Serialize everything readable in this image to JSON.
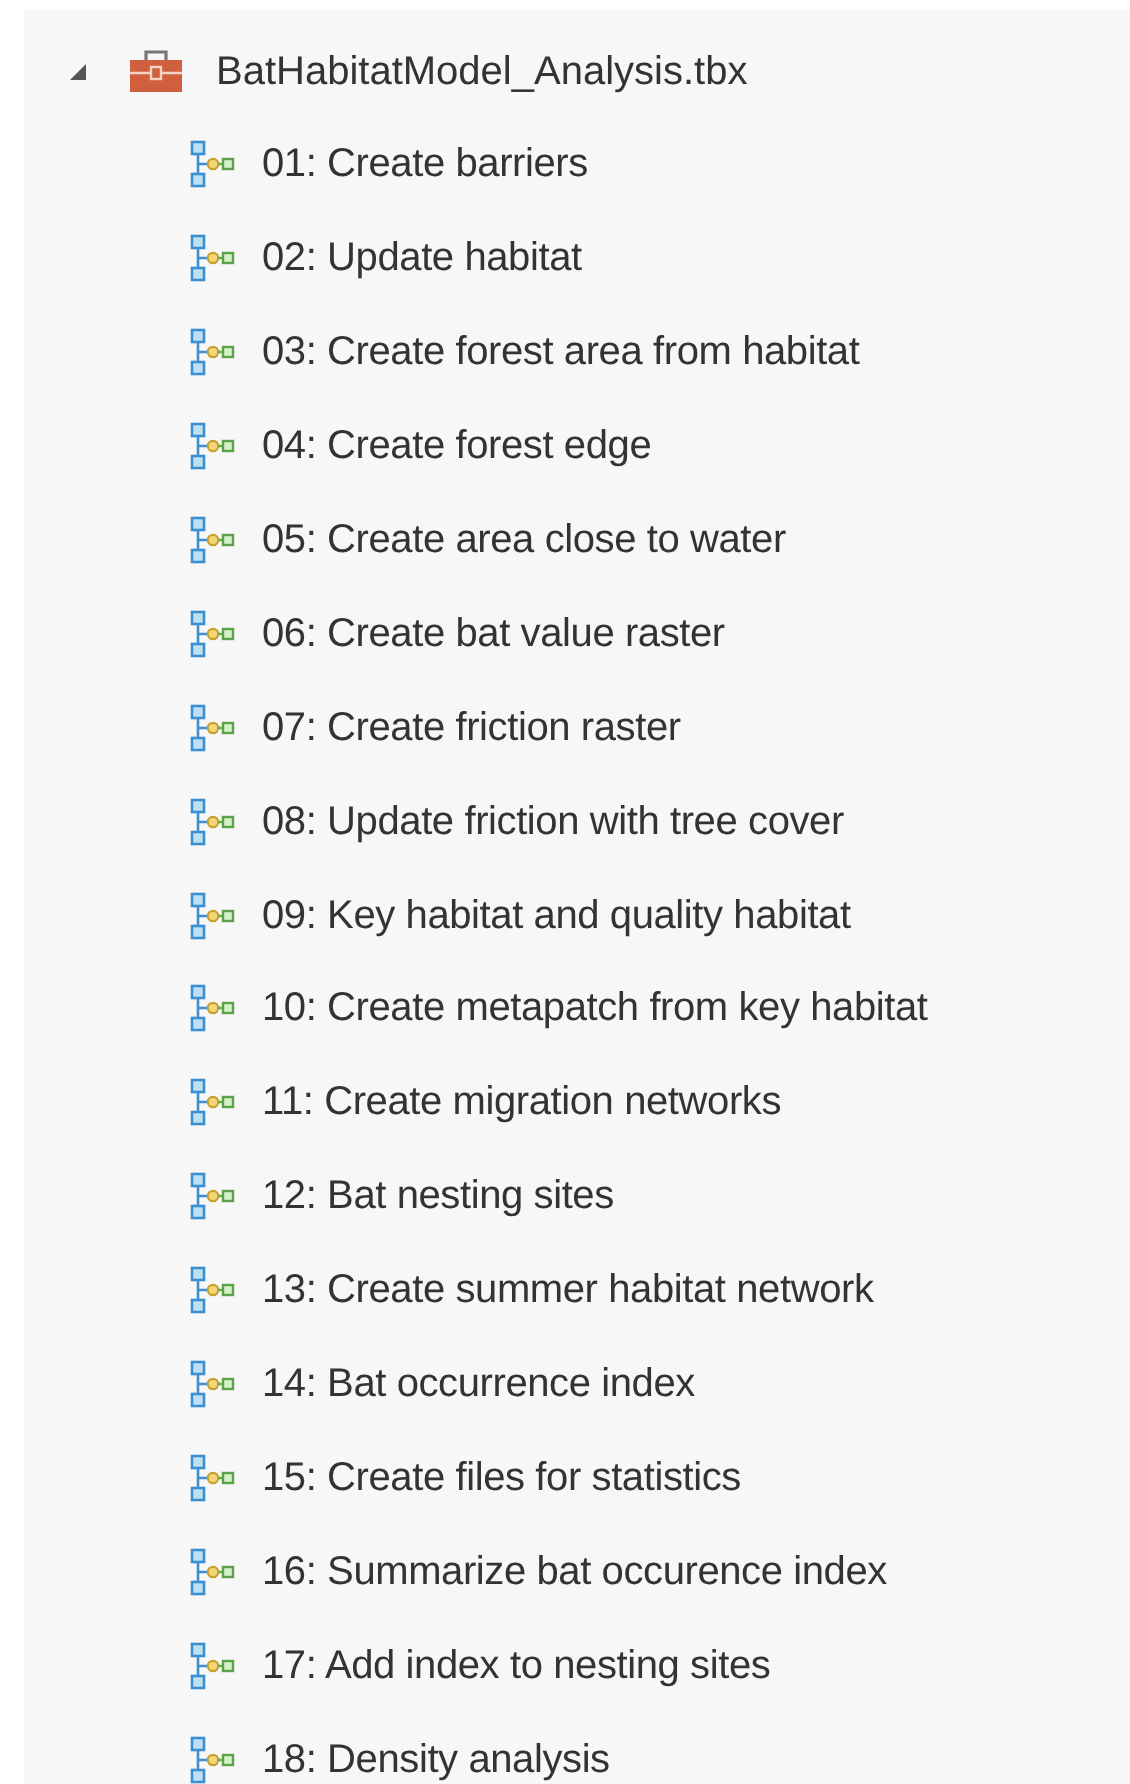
{
  "tree": {
    "label": "BatHabitatModel_Analysis.tbx",
    "expanded": true,
    "children": [
      {
        "label": "01: Create barriers"
      },
      {
        "label": "02: Update habitat"
      },
      {
        "label": "03: Create forest area from habitat"
      },
      {
        "label": "04: Create forest edge"
      },
      {
        "label": "05: Create area close to water"
      },
      {
        "label": "06: Create bat value raster"
      },
      {
        "label": "07: Create friction raster"
      },
      {
        "label": "08: Update friction with tree cover"
      },
      {
        "label": "09: Key habitat and quality habitat"
      },
      {
        "label": "10: Create metapatch from key habitat"
      },
      {
        "label": "11: Create migration networks"
      },
      {
        "label": "12: Bat nesting sites"
      },
      {
        "label": "13: Create summer habitat network"
      },
      {
        "label": "14: Bat occurrence index"
      },
      {
        "label": "15: Create files for statistics"
      },
      {
        "label": "16: Summarize bat occurence index"
      },
      {
        "label": "17: Add index to nesting sites"
      },
      {
        "label": "18: Density analysis"
      }
    ]
  }
}
